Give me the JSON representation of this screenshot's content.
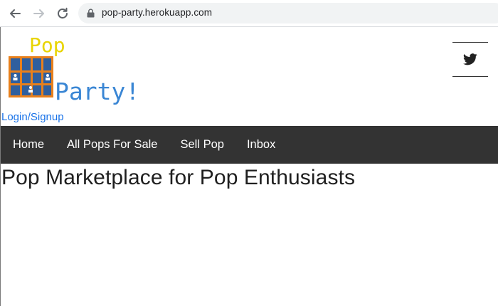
{
  "browser": {
    "url": "pop-party.herokuapp.com"
  },
  "logo": {
    "line1": "Pop",
    "line2": "Party!"
  },
  "header": {
    "login_label": "Login/Signup"
  },
  "nav": {
    "items": [
      "Home",
      "All Pops For Sale",
      "Sell Pop",
      "Inbox"
    ]
  },
  "main": {
    "title": "Pop Marketplace for Pop Enthusiasts"
  },
  "colors": {
    "navbar": "#333333",
    "link": "#1a73e8",
    "logo_pop": "#e8d400",
    "logo_party": "#3a86d4",
    "logo_frame": "#e8801c",
    "logo_panel": "#2f5f9e"
  }
}
